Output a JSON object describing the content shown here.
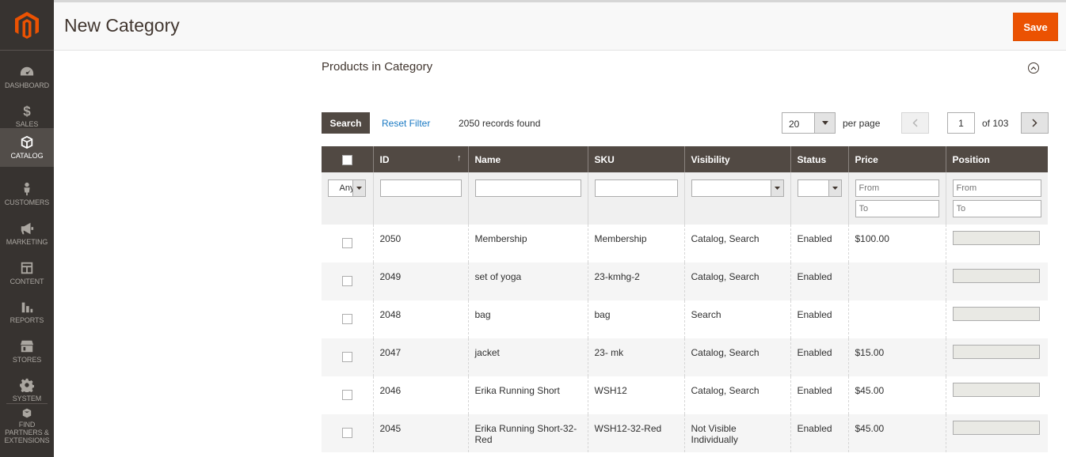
{
  "nav": {
    "items": [
      {
        "label": "DASHBOARD",
        "icon": "dashboard-icon"
      },
      {
        "label": "SALES",
        "icon": "dollar-icon"
      },
      {
        "label": "CATALOG",
        "icon": "box-icon"
      },
      {
        "label": "CUSTOMERS",
        "icon": "person-icon"
      },
      {
        "label": "MARKETING",
        "icon": "megaphone-icon"
      },
      {
        "label": "CONTENT",
        "icon": "layout-icon"
      },
      {
        "label": "REPORTS",
        "icon": "bar-chart-icon"
      },
      {
        "label": "STORES",
        "icon": "store-icon"
      },
      {
        "label": "SYSTEM",
        "icon": "gear-icon"
      },
      {
        "label": "FIND PARTNERS & EXTENSIONS",
        "icon": "extensions-icon"
      }
    ],
    "active": "CATALOG"
  },
  "header": {
    "title": "New Category",
    "save_label": "Save"
  },
  "section": {
    "title": "Products in Category"
  },
  "toolbar": {
    "search_label": "Search",
    "reset_label": "Reset Filter",
    "records_text": "2050 records found",
    "per_page_value": "20",
    "per_page_label": "per page",
    "page_value": "1",
    "of_pages": "of 103"
  },
  "table": {
    "columns": [
      "ID",
      "Name",
      "SKU",
      "Visibility",
      "Status",
      "Price",
      "Position"
    ],
    "filters": {
      "any": "Any",
      "price_from": "From",
      "price_to": "To",
      "position_from": "From",
      "position_to": "To"
    },
    "rows": [
      {
        "id": "2050",
        "name": "Membership",
        "sku": "Membership",
        "visibility": "Catalog, Search",
        "status": "Enabled",
        "price": "$100.00"
      },
      {
        "id": "2049",
        "name": "set of yoga",
        "sku": "23-kmhg-2",
        "visibility": "Catalog, Search",
        "status": "Enabled",
        "price": ""
      },
      {
        "id": "2048",
        "name": "bag",
        "sku": "bag",
        "visibility": "Search",
        "status": "Enabled",
        "price": ""
      },
      {
        "id": "2047",
        "name": "jacket",
        "sku": "23- mk",
        "visibility": "Catalog, Search",
        "status": "Enabled",
        "price": "$15.00"
      },
      {
        "id": "2046",
        "name": "Erika Running Short",
        "sku": "WSH12",
        "visibility": "Catalog, Search",
        "status": "Enabled",
        "price": "$45.00"
      },
      {
        "id": "2045",
        "name": "Erika Running Short-32-Red",
        "sku": "WSH12-32-Red",
        "visibility": "Not Visible Individually",
        "status": "Enabled",
        "price": "$45.00"
      }
    ]
  },
  "colors": {
    "accent": "#eb5202",
    "sidebar": "#373330",
    "header_dark": "#514943",
    "link": "#1979c3"
  }
}
